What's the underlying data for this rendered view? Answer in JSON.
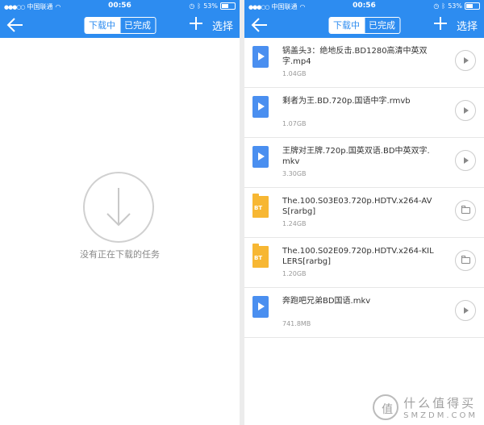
{
  "status": {
    "carrier": "中国联通",
    "time": "00:56",
    "battery": "53%",
    "signal_dots": "●●●○○"
  },
  "nav": {
    "tab_downloading": "下载中",
    "tab_done": "已完成",
    "select_label": "选择"
  },
  "left": {
    "empty_text": "没有正在下载的任务"
  },
  "files": [
    {
      "name": "锅盖头3：绝地反击.BD1280高清中英双字.mp4",
      "size": "1.04GB",
      "type": "video",
      "action": "play"
    },
    {
      "name": "剩者为王.BD.720p.国语中字.rmvb",
      "size": "1.07GB",
      "type": "video",
      "action": "play"
    },
    {
      "name": "王牌对王牌.720p.国英双语.BD中英双字.mkv",
      "size": "3.30GB",
      "type": "video",
      "action": "play"
    },
    {
      "name": "The.100.S03E03.720p.HDTV.x264-AVS[rarbg]",
      "size": "1.24GB",
      "type": "bt",
      "action": "folder"
    },
    {
      "name": "The.100.S02E09.720p.HDTV.x264-KILLERS[rarbg]",
      "size": "1.20GB",
      "type": "bt",
      "action": "folder"
    },
    {
      "name": "奔跑吧兄弟BD国语.mkv",
      "size": "741.8MB",
      "type": "video",
      "action": "play"
    }
  ],
  "bt_label": "BT",
  "watermark": {
    "symbol": "值",
    "cn": "什么值得买",
    "en": "SMZDM.COM"
  },
  "colors": {
    "accent": "#2d8cf0",
    "video_icon": "#4a8ff0",
    "bt_icon": "#f7b733"
  }
}
